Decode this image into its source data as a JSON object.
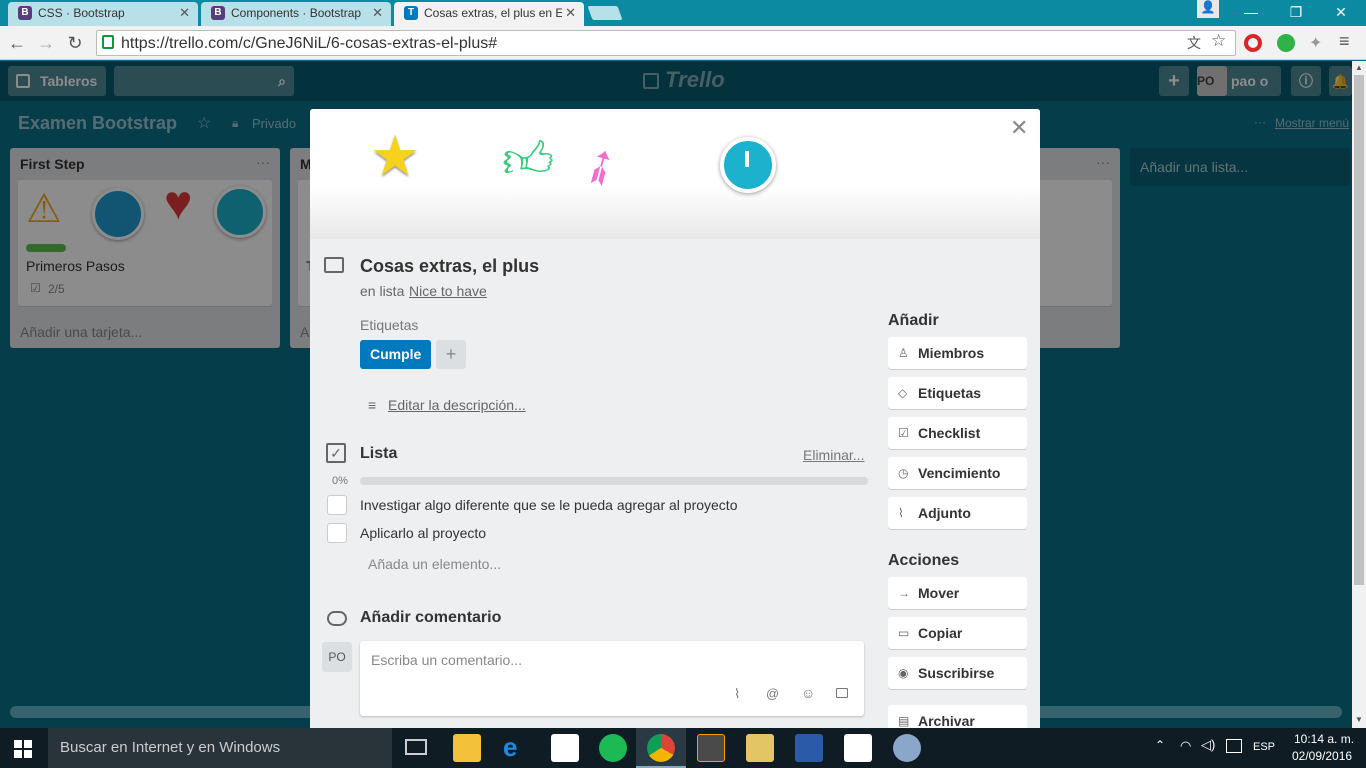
{
  "browser": {
    "tabs": [
      {
        "label": "CSS · Bootstrap",
        "favicon": "B"
      },
      {
        "label": "Components · Bootstrap",
        "favicon": "B"
      },
      {
        "label": "Cosas extras, el plus en Ex",
        "favicon": "T"
      }
    ],
    "url": "https://trello.com/c/GneJ6NiL/6-cosas-extras-el-plus#"
  },
  "trello": {
    "boards_label": "Tableros",
    "logo": "Trello",
    "user_initials": "PO",
    "user_name": "pao o",
    "board_title": "Examen Bootstrap",
    "visibility": "Privado",
    "show_menu": "Mostrar menú",
    "lists": [
      {
        "title": "First Step",
        "card_title": "Primeros Pasos",
        "checklist_badge": "2/5",
        "add_card": "Añadir una tarjeta..."
      },
      {
        "title": "M",
        "card_title": "T",
        "add_card": "A"
      }
    ],
    "add_list": "Añadir una lista..."
  },
  "card": {
    "title": "Cosas extras, el plus",
    "in_list_prefix": "en lista",
    "list_name": "Nice to have",
    "labels_heading": "Etiquetas",
    "label": "Cumple",
    "label_color": "#0079bf",
    "edit_description": "Editar la descripción...",
    "checklist": {
      "title": "Lista",
      "delete": "Eliminar...",
      "progress_text": "0%",
      "progress": 0,
      "items": [
        {
          "text": "Investigar algo diferente que se le pueda agregar al proyecto",
          "checked": false
        },
        {
          "text": "Aplicarlo al proyecto",
          "checked": false
        }
      ],
      "add_item": "Añada un elemento..."
    },
    "comment": {
      "heading": "Añadir comentario",
      "avatar": "PO",
      "placeholder": "Escriba un comentario..."
    },
    "sidebar": {
      "add_heading": "Añadir",
      "add_buttons": [
        "Miembros",
        "Etiquetas",
        "Checklist",
        "Vencimiento",
        "Adjunto"
      ],
      "actions_heading": "Acciones",
      "action_buttons": [
        "Mover",
        "Copiar",
        "Suscribirse",
        "Archivar"
      ]
    }
  },
  "taskbar": {
    "search_placeholder": "Buscar en Internet y en Windows",
    "language": "ESP",
    "time": "10:14 a. m.",
    "date": "02/09/2016"
  }
}
